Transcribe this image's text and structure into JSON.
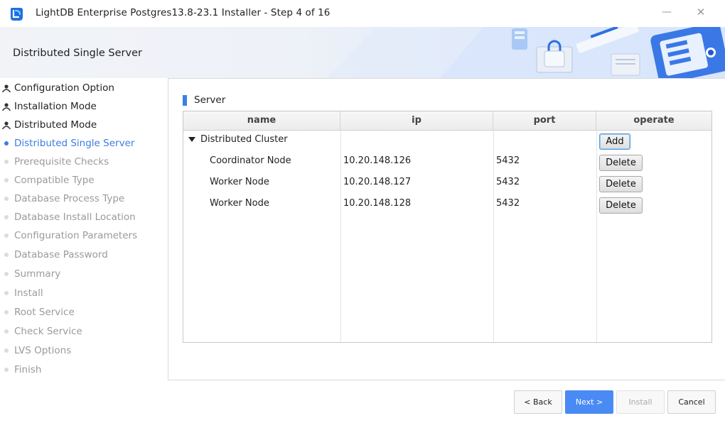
{
  "window": {
    "title": "LightDB Enterprise Postgres13.8-23.1 Installer - Step 4 of 16",
    "minimize_symbol": "—",
    "close_symbol": "✕"
  },
  "banner": {
    "title": "Distributed Single Server"
  },
  "steps": [
    {
      "label": "Configuration Option",
      "state": "done",
      "icon": "user-icon"
    },
    {
      "label": "Installation Mode",
      "state": "done",
      "icon": "user-icon"
    },
    {
      "label": "Distributed Mode",
      "state": "done",
      "icon": "user-icon"
    },
    {
      "label": "Distributed Single Server",
      "state": "current",
      "icon": "dot-icon"
    },
    {
      "label": "Prerequisite Checks",
      "state": "pending",
      "icon": "dot-icon"
    },
    {
      "label": "Compatible Type",
      "state": "pending",
      "icon": "dot-icon"
    },
    {
      "label": "Database Process Type",
      "state": "pending",
      "icon": "dot-icon"
    },
    {
      "label": "Database Install Location",
      "state": "pending",
      "icon": "dot-icon"
    },
    {
      "label": "Configuration Parameters",
      "state": "pending",
      "icon": "dot-icon"
    },
    {
      "label": "Database Password",
      "state": "pending",
      "icon": "dot-icon"
    },
    {
      "label": "Summary",
      "state": "pending",
      "icon": "dot-icon"
    },
    {
      "label": "Install",
      "state": "pending",
      "icon": "dot-icon"
    },
    {
      "label": "Root Service",
      "state": "pending",
      "icon": "dot-icon"
    },
    {
      "label": "Check Service",
      "state": "pending",
      "icon": "dot-icon"
    },
    {
      "label": "LVS Options",
      "state": "pending",
      "icon": "dot-icon"
    },
    {
      "label": "Finish",
      "state": "pending",
      "icon": "dot-icon"
    }
  ],
  "server": {
    "section_title": "Server",
    "columns": [
      "name",
      "ip",
      "port",
      "operate"
    ],
    "cluster": {
      "name": "Distributed Cluster",
      "action": "Add",
      "expanded": true
    },
    "nodes": [
      {
        "name": "Coordinator Node",
        "ip": "10.20.148.126",
        "port": "5432",
        "action": "Delete"
      },
      {
        "name": "Worker Node",
        "ip": "10.20.148.127",
        "port": "5432",
        "action": "Delete"
      },
      {
        "name": "Worker Node",
        "ip": "10.20.148.128",
        "port": "5432",
        "action": "Delete"
      }
    ]
  },
  "footer": {
    "back_label": "< Back",
    "next_label": "Next >",
    "install_label": "Install",
    "cancel_label": "Cancel"
  },
  "colors": {
    "accent": "#3b7be4",
    "next_button": "#4a8af4",
    "pending_text": "#9a9a9a"
  }
}
